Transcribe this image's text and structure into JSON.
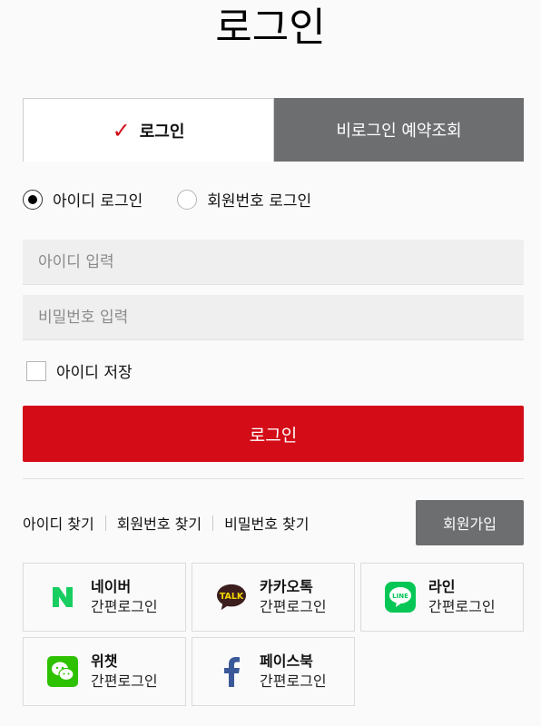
{
  "page_title": "로그인",
  "tabs": {
    "member_login": "로그인",
    "guest_reservation": "비로그인 예약조회"
  },
  "login_type": {
    "id_login": "아이디 로그인",
    "member_number_login": "회원번호 로그인",
    "selected": "id_login"
  },
  "form": {
    "id_placeholder": "아이디 입력",
    "id_value": "",
    "password_placeholder": "비밀번호 입력",
    "password_value": "",
    "save_id_label": "아이디 저장",
    "save_id_checked": false,
    "login_button": "로그인"
  },
  "find_links": {
    "find_id": "아이디 찾기",
    "find_member_number": "회원번호 찾기",
    "find_password": "비밀번호 찾기"
  },
  "join_button": "회원가입",
  "social_login": {
    "naver": {
      "name": "네이버",
      "sub": "간편로그인",
      "icon": "naver-icon",
      "color": "#19ce60"
    },
    "kakao": {
      "name": "카카오톡",
      "sub": "간편로그인",
      "icon": "kakaotalk-icon",
      "color": "#3c1e1e"
    },
    "line": {
      "name": "라인",
      "sub": "간편로그인",
      "icon": "line-icon",
      "color": "#06c755"
    },
    "wechat": {
      "name": "위챗",
      "sub": "간편로그인",
      "icon": "wechat-icon",
      "color": "#2dc100"
    },
    "facebook": {
      "name": "페이스북",
      "sub": "간편로그인",
      "icon": "facebook-icon",
      "color": "#3b5998"
    },
    "kakao_icon_text": "TALK",
    "line_icon_text": "LINE"
  },
  "colors": {
    "accent_red": "#d30c18",
    "tab_inactive": "#6d6e70",
    "join_button": "#6d6e70"
  }
}
